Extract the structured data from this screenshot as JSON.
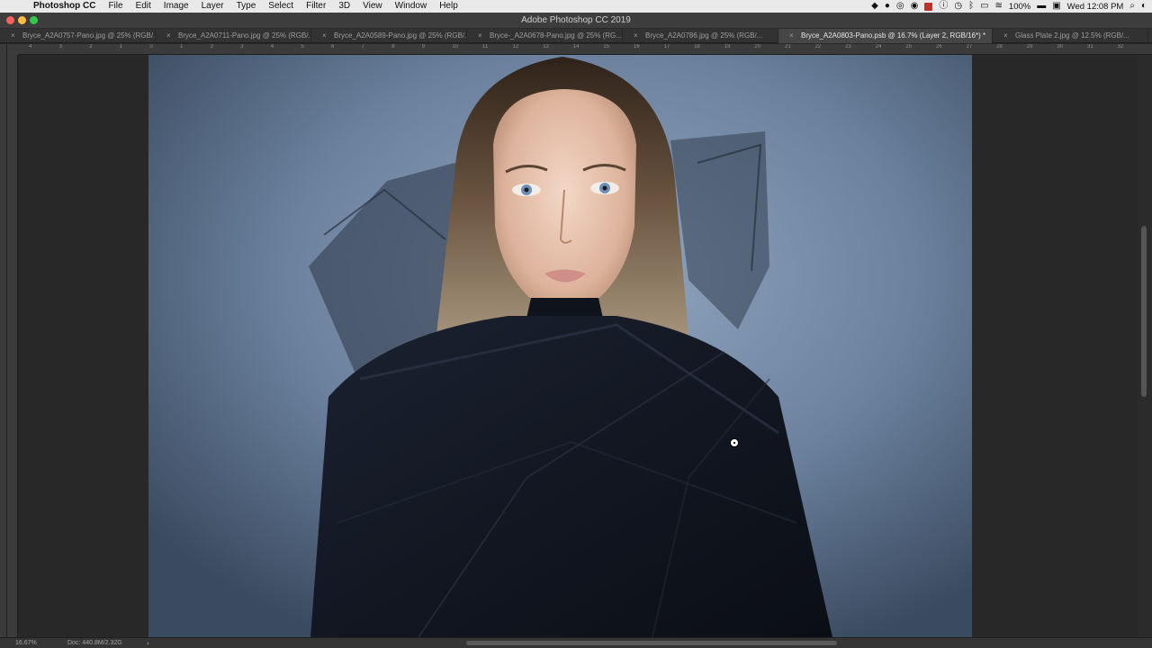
{
  "menubar": {
    "apple_glyph": "",
    "app_name": "Photoshop CC",
    "items": [
      "File",
      "Edit",
      "Image",
      "Layer",
      "Type",
      "Select",
      "Filter",
      "3D",
      "View",
      "Window",
      "Help"
    ],
    "status": {
      "battery": "100%",
      "clock": "Wed 12:08 PM",
      "icons": [
        "dropbox-icon",
        "creative-cloud-icon",
        "chrome-icon",
        "cast-icon",
        "red-app-icon",
        "info-icon",
        "time-machine-icon",
        "bluetooth-icon",
        "airplay-icon",
        "wifi-icon",
        "battery-icon",
        "display-icon",
        "spotlight-icon",
        "siri-icon"
      ]
    }
  },
  "window": {
    "title": "Adobe Photoshop CC 2019"
  },
  "tabs": [
    {
      "label": "Bryce_A2A0757-Pano.jpg @ 25% (RGB/...",
      "active": false
    },
    {
      "label": "Bryce_A2A0711-Pano.jpg @ 25% (RGB/...",
      "active": false
    },
    {
      "label": "Bryce_A2A0589-Pano.jpg @ 25% (RGB/...",
      "active": false
    },
    {
      "label": "Bryce-_A2A0678-Pano.jpg @ 25% (RG...",
      "active": false
    },
    {
      "label": "Bryce_A2A0786.jpg @ 25% (RGB/...",
      "active": false
    },
    {
      "label": "Bryce_A2A0803-Pano.psb @ 16.7% (Layer 2, RGB/16*) *",
      "active": true
    },
    {
      "label": "Glass Plate 2.jpg @ 12.5% (RGB/...",
      "active": false
    }
  ],
  "ruler": {
    "ticks": [
      "4",
      "3",
      "2",
      "1",
      "0",
      "1",
      "2",
      "3",
      "4",
      "5",
      "6",
      "7",
      "8",
      "9",
      "10",
      "11",
      "12",
      "13",
      "14",
      "15",
      "16",
      "17",
      "18",
      "19",
      "20",
      "21",
      "22",
      "23",
      "24",
      "25",
      "26",
      "27",
      "28",
      "29",
      "30",
      "31",
      "32"
    ]
  },
  "statusbar": {
    "zoom": "16.67%",
    "doc": "Doc: 440.8M/2.32G",
    "arrow": "›"
  }
}
